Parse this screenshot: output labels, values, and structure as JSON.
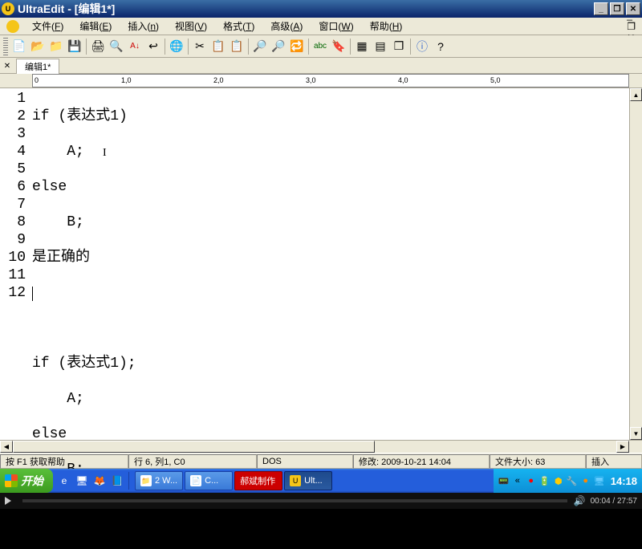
{
  "titlebar": {
    "title": "UltraEdit - [编辑1*]"
  },
  "menu": {
    "items": [
      {
        "label": "文件(",
        "hotkey": "F",
        "suffix": ")"
      },
      {
        "label": "编辑(",
        "hotkey": "E",
        "suffix": ")"
      },
      {
        "label": "插入(",
        "hotkey": "n",
        "suffix": ")"
      },
      {
        "label": "视图(",
        "hotkey": "V",
        "suffix": ")"
      },
      {
        "label": "格式(",
        "hotkey": "T",
        "suffix": ")"
      },
      {
        "label": "高级(",
        "hotkey": "A",
        "suffix": ")"
      },
      {
        "label": "窗口(",
        "hotkey": "W",
        "suffix": ")"
      },
      {
        "label": "帮助(",
        "hotkey": "H",
        "suffix": ")"
      }
    ]
  },
  "tabs": {
    "tab1": "编辑1*"
  },
  "ruler": {
    "marks": [
      "0",
      "1,0",
      "2,0",
      "3,0",
      "4,0",
      "5,0"
    ]
  },
  "editor": {
    "lines": [
      "if (表达式1)",
      "    A;",
      "else",
      "    B;",
      "是正确的",
      "",
      "",
      "if (表达式1);",
      "    A;",
      "else",
      "    B;",
      ""
    ],
    "line_numbers": [
      "1",
      "2",
      "3",
      "4",
      "5",
      "6",
      "7",
      "8",
      "9",
      "10",
      "11",
      "12"
    ]
  },
  "statusbar": {
    "help": "按 F1 获取帮助",
    "position": "行 6, 列1, C0",
    "encoding": "DOS",
    "modified": "修改:  2009-10-21 14:04",
    "filesize": "文件大小:  63",
    "mode": "插入"
  },
  "taskbar": {
    "start": "开始",
    "tasks": [
      {
        "icon": "📁",
        "label": "2 W...",
        "active": false
      },
      {
        "icon": "📄",
        "label": "C...",
        "active": false
      },
      {
        "icon": "🔴",
        "label": "郝斌制作",
        "active": false,
        "red": true
      },
      {
        "icon": "🟡",
        "label": "Ult...",
        "active": true
      }
    ],
    "clock": "14:18"
  },
  "mediabar": {
    "time": "00:04 / 27:57"
  }
}
